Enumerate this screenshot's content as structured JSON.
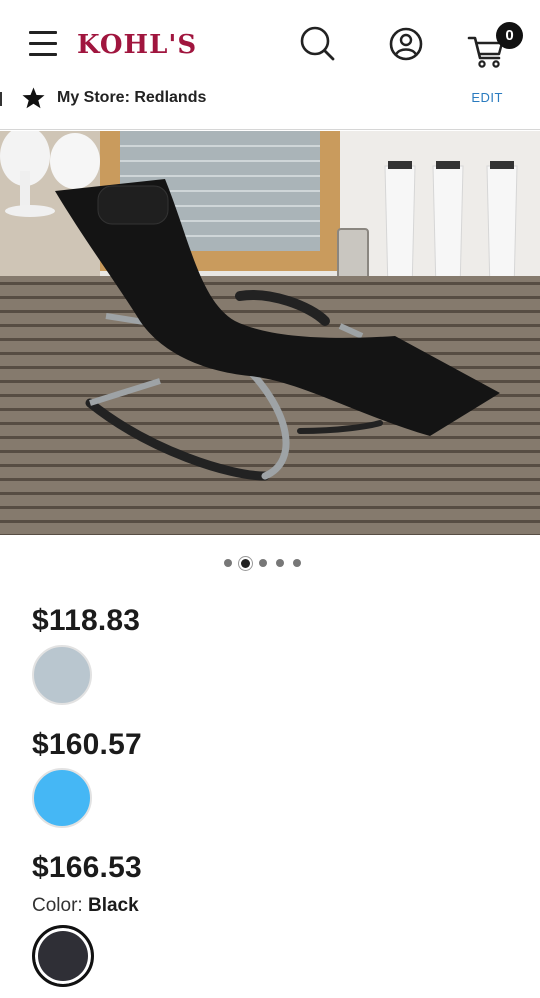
{
  "header": {
    "logo_text": "KOHL'S",
    "logo_color": "#a0153e",
    "cart_count": "0"
  },
  "store_bar": {
    "label": "My Store: Redlands",
    "edit_label": "EDIT"
  },
  "gallery": {
    "dot_count": 5,
    "active_index": 1
  },
  "variants": [
    {
      "price": "$118.83",
      "swatch_color": "#b9c6cf"
    },
    {
      "price": "$160.57",
      "swatch_color": "#45b7f5"
    },
    {
      "price": "$166.53",
      "swatch_color": "#2f2f36",
      "color_label": "Color:",
      "color_value": "Black",
      "selected": true
    }
  ]
}
